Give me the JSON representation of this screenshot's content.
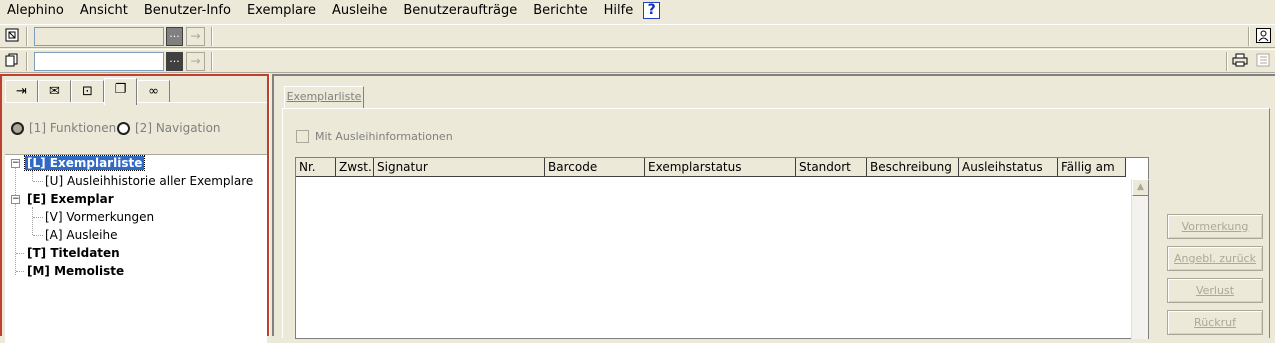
{
  "menu": {
    "items": [
      "Alephino",
      "Ansicht",
      "Benutzer-Info",
      "Exemplare",
      "Ausleihe",
      "Benutzeraufträge",
      "Berichte",
      "Hilfe"
    ],
    "help_icon": "?"
  },
  "toolbar1": {
    "left_icon": "user-card-icon",
    "input_value": "",
    "dots_label": "···",
    "go_label": "→",
    "right_icon": "person-icon"
  },
  "toolbar2": {
    "left_icon": "copy-icon",
    "input_value": "",
    "dots_label": "···",
    "go_label": "→",
    "right_icons": [
      "printer-icon",
      "list-icon"
    ]
  },
  "left_tabs": [
    {
      "icon": "exit-icon",
      "glyph": "⇥"
    },
    {
      "icon": "user-icon",
      "glyph": "⛶"
    },
    {
      "icon": "card-icon",
      "glyph": "▣"
    },
    {
      "icon": "copy-icon",
      "glyph": "❐"
    },
    {
      "icon": "binoculars-icon",
      "glyph": "⛁"
    }
  ],
  "radios": [
    {
      "label": "[1] Funktionen",
      "selected": true
    },
    {
      "label": "[2] Navigation",
      "selected": false
    }
  ],
  "tree": [
    {
      "label": "[L] Exemplarliste",
      "level": 0,
      "bold": true,
      "selected": true,
      "expander": "−"
    },
    {
      "label": "[U] Ausleihhistorie aller Exemplare",
      "level": 1,
      "bold": false
    },
    {
      "label": "[E] Exemplar",
      "level": 0,
      "bold": true,
      "expander": "−"
    },
    {
      "label": "[V] Vormerkungen",
      "level": 1,
      "bold": false
    },
    {
      "label": "[A] Ausleihe",
      "level": 1,
      "bold": false
    },
    {
      "label": "[T] Titeldaten",
      "level": 0,
      "bold": true
    },
    {
      "label": "[M] Memoliste",
      "level": 0,
      "bold": true
    }
  ],
  "right_tab": "Exemplarliste",
  "checkbox_label": "Mit Ausleihinformationen",
  "table": {
    "columns": [
      "Nr.",
      "Zwst.",
      "Signatur",
      "Barcode",
      "Exemplarstatus",
      "Standort",
      "Beschreibung",
      "Ausleihstatus",
      "Fällig am"
    ],
    "rows": []
  },
  "scroll_up": "▲",
  "actions": [
    "Vormerkung",
    "Angebl. zurück",
    "Verlust",
    "Rückruf"
  ]
}
